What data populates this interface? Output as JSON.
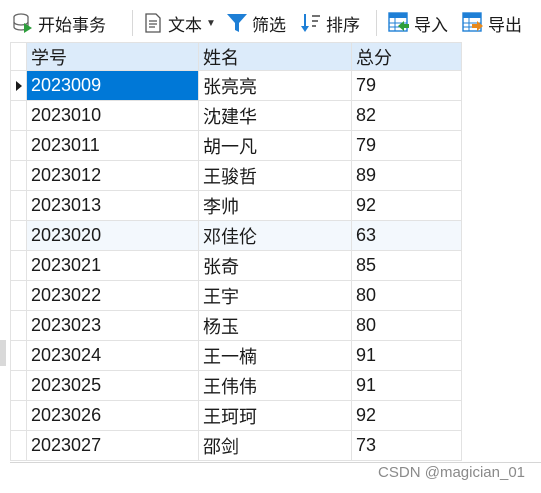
{
  "toolbar": {
    "begin_transaction": "开始事务",
    "text": "文本",
    "filter": "筛选",
    "sort": "排序",
    "import": "导入",
    "export": "导出"
  },
  "table": {
    "columns": [
      "学号",
      "姓名",
      "总分"
    ],
    "rows": [
      [
        "2023009",
        "张亮亮",
        "79"
      ],
      [
        "2023010",
        "沈建华",
        "82"
      ],
      [
        "2023011",
        "胡一凡",
        "79"
      ],
      [
        "2023012",
        "王骏哲",
        "89"
      ],
      [
        "2023013",
        "李帅",
        "92"
      ],
      [
        "2023020",
        "邓佳伦",
        "63"
      ],
      [
        "2023021",
        "张奇",
        "85"
      ],
      [
        "2023022",
        "王宇",
        "80"
      ],
      [
        "2023023",
        "杨玉",
        "80"
      ],
      [
        "2023024",
        "王一楠",
        "91"
      ],
      [
        "2023025",
        "王伟伟",
        "91"
      ],
      [
        "2023026",
        "王珂珂",
        "92"
      ],
      [
        "2023027",
        "邵剑",
        "73"
      ]
    ],
    "selected_row": 0,
    "highlighted_row": 5
  },
  "watermark": "CSDN @magician_01",
  "colors": {
    "header_bg": "#dcebfa",
    "selection": "#0078d7",
    "alt_row": "#f3f8fd"
  }
}
